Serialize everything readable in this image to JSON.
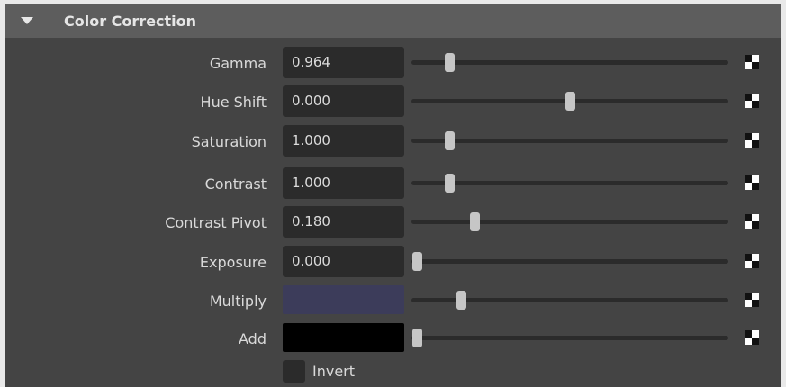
{
  "section": {
    "title": "Color Correction"
  },
  "attributes": [
    {
      "label": "Gamma",
      "value": "0.964",
      "slider": 0.12
    },
    {
      "label": "Hue Shift",
      "value": "0.000",
      "slider": 0.5
    },
    {
      "label": "Saturation",
      "value": "1.000",
      "slider": 0.12
    },
    {
      "label": "Contrast",
      "value": "1.000",
      "slider": 0.12
    },
    {
      "label": "Contrast Pivot",
      "value": "0.180",
      "slider": 0.2
    },
    {
      "label": "Exposure",
      "value": "0.000",
      "slider": 0.0
    },
    {
      "label": "Multiply",
      "color": "#3c3c5a",
      "slider": 0.155
    },
    {
      "label": "Add",
      "color": "#000000",
      "slider": 0.0
    }
  ],
  "invert": {
    "label": "Invert",
    "checked": false
  }
}
